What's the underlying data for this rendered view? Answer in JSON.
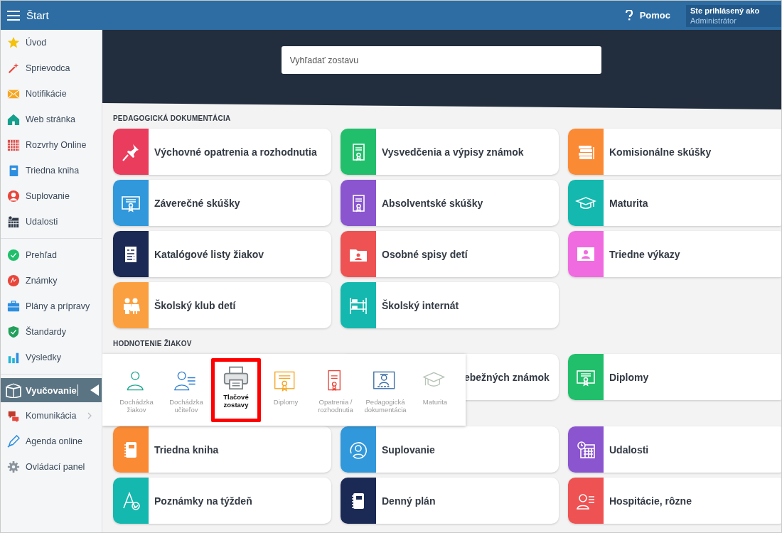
{
  "header": {
    "title": "Štart",
    "help": "Pomoc",
    "user_label": "Ste prihlásený ako",
    "user_name": "Administrátor"
  },
  "search": {
    "placeholder": "Vyhľadať zostavu"
  },
  "sidebar": {
    "groups": [
      {
        "items": [
          {
            "label": "Úvod",
            "selected": false,
            "submenu": false
          },
          {
            "label": "Sprievodca",
            "selected": false,
            "submenu": false
          },
          {
            "label": "Notifikácie",
            "selected": false,
            "submenu": false
          },
          {
            "label": "Web stránka",
            "selected": false,
            "submenu": false
          },
          {
            "label": "Rozvrhy Online",
            "selected": false,
            "submenu": false
          },
          {
            "label": "Triedna kniha",
            "selected": false,
            "submenu": false
          },
          {
            "label": "Suplovanie",
            "selected": false,
            "submenu": false
          },
          {
            "label": "Udalosti",
            "selected": false,
            "submenu": false
          }
        ]
      },
      {
        "items": [
          {
            "label": "Prehľad",
            "selected": false,
            "submenu": false
          },
          {
            "label": "Známky",
            "selected": false,
            "submenu": false
          },
          {
            "label": "Plány a prípravy",
            "selected": false,
            "submenu": false
          },
          {
            "label": "Štandardy",
            "selected": false,
            "submenu": false
          },
          {
            "label": "Výsledky",
            "selected": false,
            "submenu": false
          }
        ]
      },
      {
        "items": [
          {
            "label": "Vyučovanie",
            "selected": true,
            "submenu": false
          },
          {
            "label": "Komunikácia",
            "selected": false,
            "submenu": true
          },
          {
            "label": "Agenda online",
            "selected": false,
            "submenu": false
          },
          {
            "label": "Ovládací panel",
            "selected": false,
            "submenu": false
          }
        ]
      }
    ]
  },
  "sections": [
    {
      "title": "PEDAGOGICKÁ DOKUMENTÁCIA",
      "cards": [
        {
          "label": "Výchovné opatrenia a rozhodnutia",
          "color": "#ea3c5c"
        },
        {
          "label": "Vysvedčenia a výpisy známok",
          "color": "#21bf6b"
        },
        {
          "label": "Komisionálne skúšky",
          "color": "#fb8a35"
        },
        {
          "label": "Záverečné skúšky",
          "color": "#3098db"
        },
        {
          "label": "Absolventské skúšky",
          "color": "#8a55cf"
        },
        {
          "label": "Maturita",
          "color": "#14b8ae"
        },
        {
          "label": "Katalógové listy žiakov",
          "color": "#1b2a55"
        },
        {
          "label": "Osobné spisy detí",
          "color": "#ee5253"
        },
        {
          "label": "Triedne výkazy",
          "color": "#f06bdf"
        },
        {
          "label": "Školský klub detí",
          "color": "#fba040"
        },
        {
          "label": "Školský internát",
          "color": "#14b8ae"
        }
      ]
    },
    {
      "title": "HODNOTENIE ŽIAKOV",
      "popup": {
        "items": [
          {
            "label": "Dochádzka žiakov",
            "selected": false
          },
          {
            "label": "Dochádzka učiteľov",
            "selected": false
          },
          {
            "label": "Tlačové zostavy",
            "selected": true
          },
          {
            "label": "Diplomy",
            "selected": false
          },
          {
            "label": "Opatrenia / rozhodnutia",
            "selected": false
          },
          {
            "label": "Pedagogická dokumentácia",
            "selected": false
          },
          {
            "label": "Maturita",
            "selected": false
          }
        ]
      },
      "cards": [
        {
          "label": "ebežných známok",
          "covered": true
        },
        {
          "label": "Diplomy",
          "color": "#21bf6b"
        },
        {
          "label": "Triedna kniha",
          "color": "#fb8a35"
        },
        {
          "label": "Suplovanie",
          "color": "#3098db"
        },
        {
          "label": "Udalosti",
          "color": "#8a55cf"
        },
        {
          "label": "Poznámky na týždeň",
          "color": "#14b8ae"
        },
        {
          "label": "Denný plán",
          "color": "#1b2a55"
        },
        {
          "label": "Hospitácie, rôzne",
          "color": "#ee5253"
        }
      ]
    }
  ]
}
